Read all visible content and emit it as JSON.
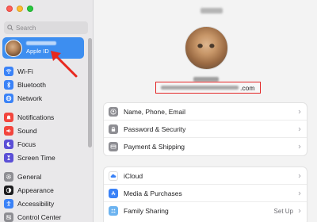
{
  "sidebar": {
    "search_placeholder": "Search",
    "apple_id": {
      "subtitle": "Apple ID"
    },
    "groups": [
      [
        {
          "label": "Wi-Fi",
          "icon": "wifi-icon",
          "color": "#3a82f7"
        },
        {
          "label": "Bluetooth",
          "icon": "bluetooth-icon",
          "color": "#3a82f7"
        },
        {
          "label": "Network",
          "icon": "network-icon",
          "color": "#3a82f7"
        }
      ],
      [
        {
          "label": "Notifications",
          "icon": "bell-icon",
          "color": "#f2453d"
        },
        {
          "label": "Sound",
          "icon": "speaker-icon",
          "color": "#f2453d"
        },
        {
          "label": "Focus",
          "icon": "moon-icon",
          "color": "#5b4fd6"
        },
        {
          "label": "Screen Time",
          "icon": "hourglass-icon",
          "color": "#5b4fd6"
        }
      ],
      [
        {
          "label": "General",
          "icon": "gear-icon",
          "color": "#8e8e93"
        },
        {
          "label": "Appearance",
          "icon": "circle-half-icon",
          "color": "#1d1d1f"
        },
        {
          "label": "Accessibility",
          "icon": "accessibility-icon",
          "color": "#3a82f7"
        },
        {
          "label": "Control Center",
          "icon": "control-center-icon",
          "color": "#8e8e93"
        }
      ]
    ]
  },
  "main": {
    "email_suffix": ".com",
    "card1": [
      {
        "label": "Name, Phone, Email",
        "icon": "person-icon"
      },
      {
        "label": "Password & Security",
        "icon": "lock-icon"
      },
      {
        "label": "Payment & Shipping",
        "icon": "card-icon"
      }
    ],
    "card2": [
      {
        "label": "iCloud",
        "icon": "cloud-icon",
        "value": ""
      },
      {
        "label": "Media & Purchases",
        "icon": "app-store-icon",
        "value": ""
      },
      {
        "label": "Family Sharing",
        "icon": "family-icon",
        "value": "Set Up"
      }
    ]
  }
}
